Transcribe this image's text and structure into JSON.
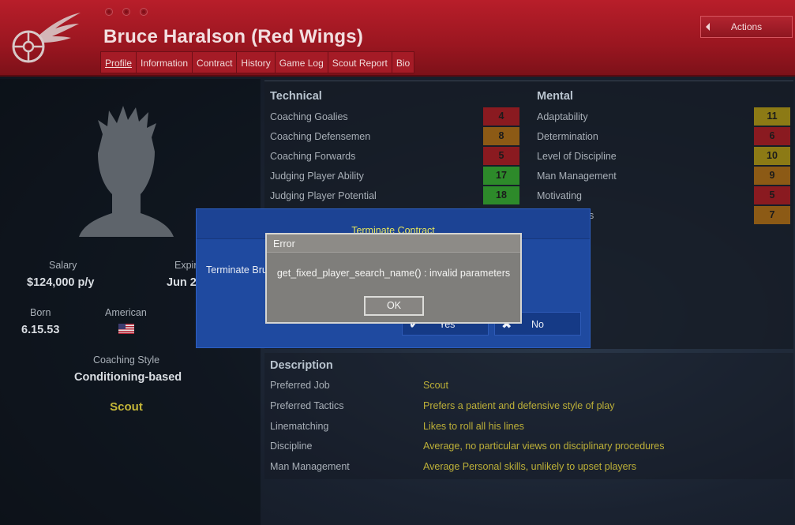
{
  "header": {
    "player_title": "Bruce Haralson (Red Wings)",
    "actions_label": "Actions",
    "tabs": [
      {
        "label": "Profile",
        "active": true
      },
      {
        "label": "Information",
        "active": false
      },
      {
        "label": "Contract",
        "active": false
      },
      {
        "label": "History",
        "active": false
      },
      {
        "label": "Game Log",
        "active": false
      },
      {
        "label": "Scout Report",
        "active": false
      },
      {
        "label": "Bio",
        "active": false
      }
    ]
  },
  "profile": {
    "salary_label": "Salary",
    "salary_value": "$124,000 p/y",
    "expiry_label": "Expir",
    "expiry_value": "Jun 2",
    "born_label": "Born",
    "born_value": "6.15.53",
    "nationality_label": "American",
    "coaching_style_label": "Coaching Style",
    "coaching_style_value": "Conditioning-based",
    "role": "Scout"
  },
  "technical": {
    "heading": "Technical",
    "attributes": [
      {
        "name": "Coaching Goalies",
        "value": "4",
        "color": "#8a1a20"
      },
      {
        "name": "Coaching Defensemen",
        "value": "8",
        "color": "#8c5a15"
      },
      {
        "name": "Coaching Forwards",
        "value": "5",
        "color": "#8a1a20"
      },
      {
        "name": "Judging Player Ability",
        "value": "17",
        "color": "#2d8a2a"
      },
      {
        "name": "Judging Player Potential",
        "value": "18",
        "color": "#2d8a2a"
      }
    ]
  },
  "mental": {
    "heading": "Mental",
    "attributes": [
      {
        "name": "Adaptability",
        "value": "11",
        "color": "#8c7a15"
      },
      {
        "name": "Determination",
        "value": "6",
        "color": "#8a1a20"
      },
      {
        "name": "Level of Discipline",
        "value": "10",
        "color": "#8c7a15"
      },
      {
        "name": "Man Management",
        "value": "9",
        "color": "#8c5a15"
      },
      {
        "name": "Motivating",
        "value": "5",
        "color": "#8a1a20"
      },
      {
        "name": "h Youngsters",
        "value": "7",
        "color": "#8c5a15"
      }
    ]
  },
  "description": {
    "heading": "Description",
    "rows": [
      {
        "key": "Preferred Job",
        "value": "Scout"
      },
      {
        "key": "Preferred Tactics",
        "value": "Prefers a patient and defensive style of play"
      },
      {
        "key": "Linematching",
        "value": "Likes to roll all his lines"
      },
      {
        "key": "Discipline",
        "value": "Average, no particular views on disciplinary procedures"
      },
      {
        "key": "Man Management",
        "value": "Average Personal skills, unlikely to upset players"
      }
    ]
  },
  "terminate_dialog": {
    "title": "Terminate Contract",
    "text": "Terminate Bru",
    "yes_label": "Yes",
    "no_label": "No"
  },
  "error_dialog": {
    "title": "Error",
    "message": "get_fixed_player_search_name() : invalid parameters",
    "ok_label": "OK"
  }
}
